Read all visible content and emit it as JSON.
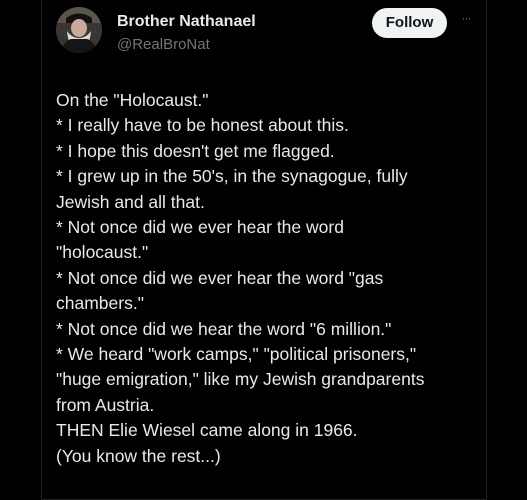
{
  "post": {
    "author": {
      "display_name": "Brother Nathanael",
      "handle": "@RealBroNat",
      "avatar_icon": "profile-photo"
    },
    "follow_label": "Follow",
    "more_icon": "more-options-icon",
    "more_glyph": "···",
    "text_lines": [
      "On the \"Holocaust.\"",
      "* I really have to be honest about this.",
      "* I hope this doesn't get me flagged.",
      "* I grew up in the 50's, in the synagogue, fully",
      "Jewish and all that.",
      "* Not once did we ever hear the word",
      "\"holocaust.\"",
      "* Not once did we ever hear the word \"gas",
      "chambers.\"",
      "* Not once did we hear the word \"6 million.\"",
      "* We heard \"work camps,\" \"political prisoners,\"",
      "\"huge emigration,\" like my Jewish grandparents",
      "from Austria.",
      "THEN Elie Wiesel came along in 1966.",
      "(You know the rest...)"
    ]
  },
  "colors": {
    "background": "#000000",
    "text": "#e7e9ea",
    "secondary_text": "#71767b",
    "follow_button_bg": "#eff3f4",
    "follow_button_text": "#0f1419"
  }
}
